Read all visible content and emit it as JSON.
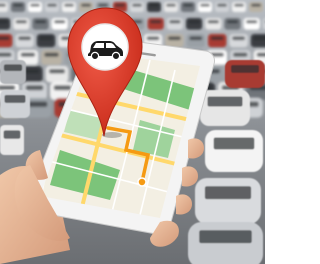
{
  "image": {
    "subject": "hand-holding-smartphone-with-map-and-car-location-pin",
    "background": "parking-lot-full-of-cars",
    "icons": [
      "map-pin-icon",
      "car-icon",
      "route-line-icon"
    ]
  },
  "colors": {
    "pin": "#e03a2a",
    "pin_dark": "#b82617",
    "route": "#f59a13",
    "map_green": "#7cc47a",
    "map_road": "#ffd86b",
    "map_land": "#f3efe3",
    "skin": "#e7b89a",
    "phone_frame": "#f2f2f2",
    "lot_asphalt": "#5f6164"
  }
}
